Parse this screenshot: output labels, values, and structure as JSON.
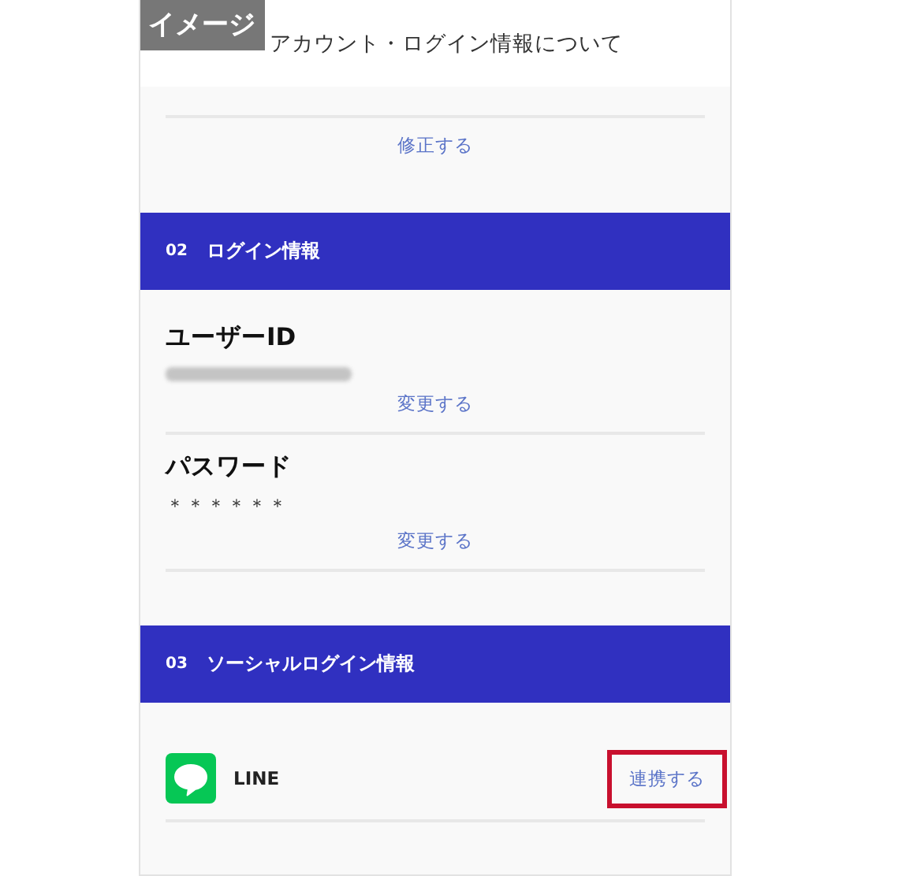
{
  "badge": "イメージ",
  "header": {
    "title": "アカウント・ログイン情報について"
  },
  "address_section": {
    "edit_link": "修正する"
  },
  "sections": [
    {
      "number": "02",
      "title": "ログイン情報",
      "kind": "fields",
      "fields": [
        {
          "label": "ユーザーID",
          "blurred": true,
          "link": "変更する"
        },
        {
          "label": "パスワード",
          "value": "＊＊＊＊＊＊",
          "blurred": false,
          "link": "変更する"
        }
      ]
    },
    {
      "number": "03",
      "title": "ソーシャルログイン情報",
      "kind": "social",
      "services": [
        {
          "name": "LINE",
          "action": "連携する",
          "highlighted": true
        }
      ]
    }
  ]
}
